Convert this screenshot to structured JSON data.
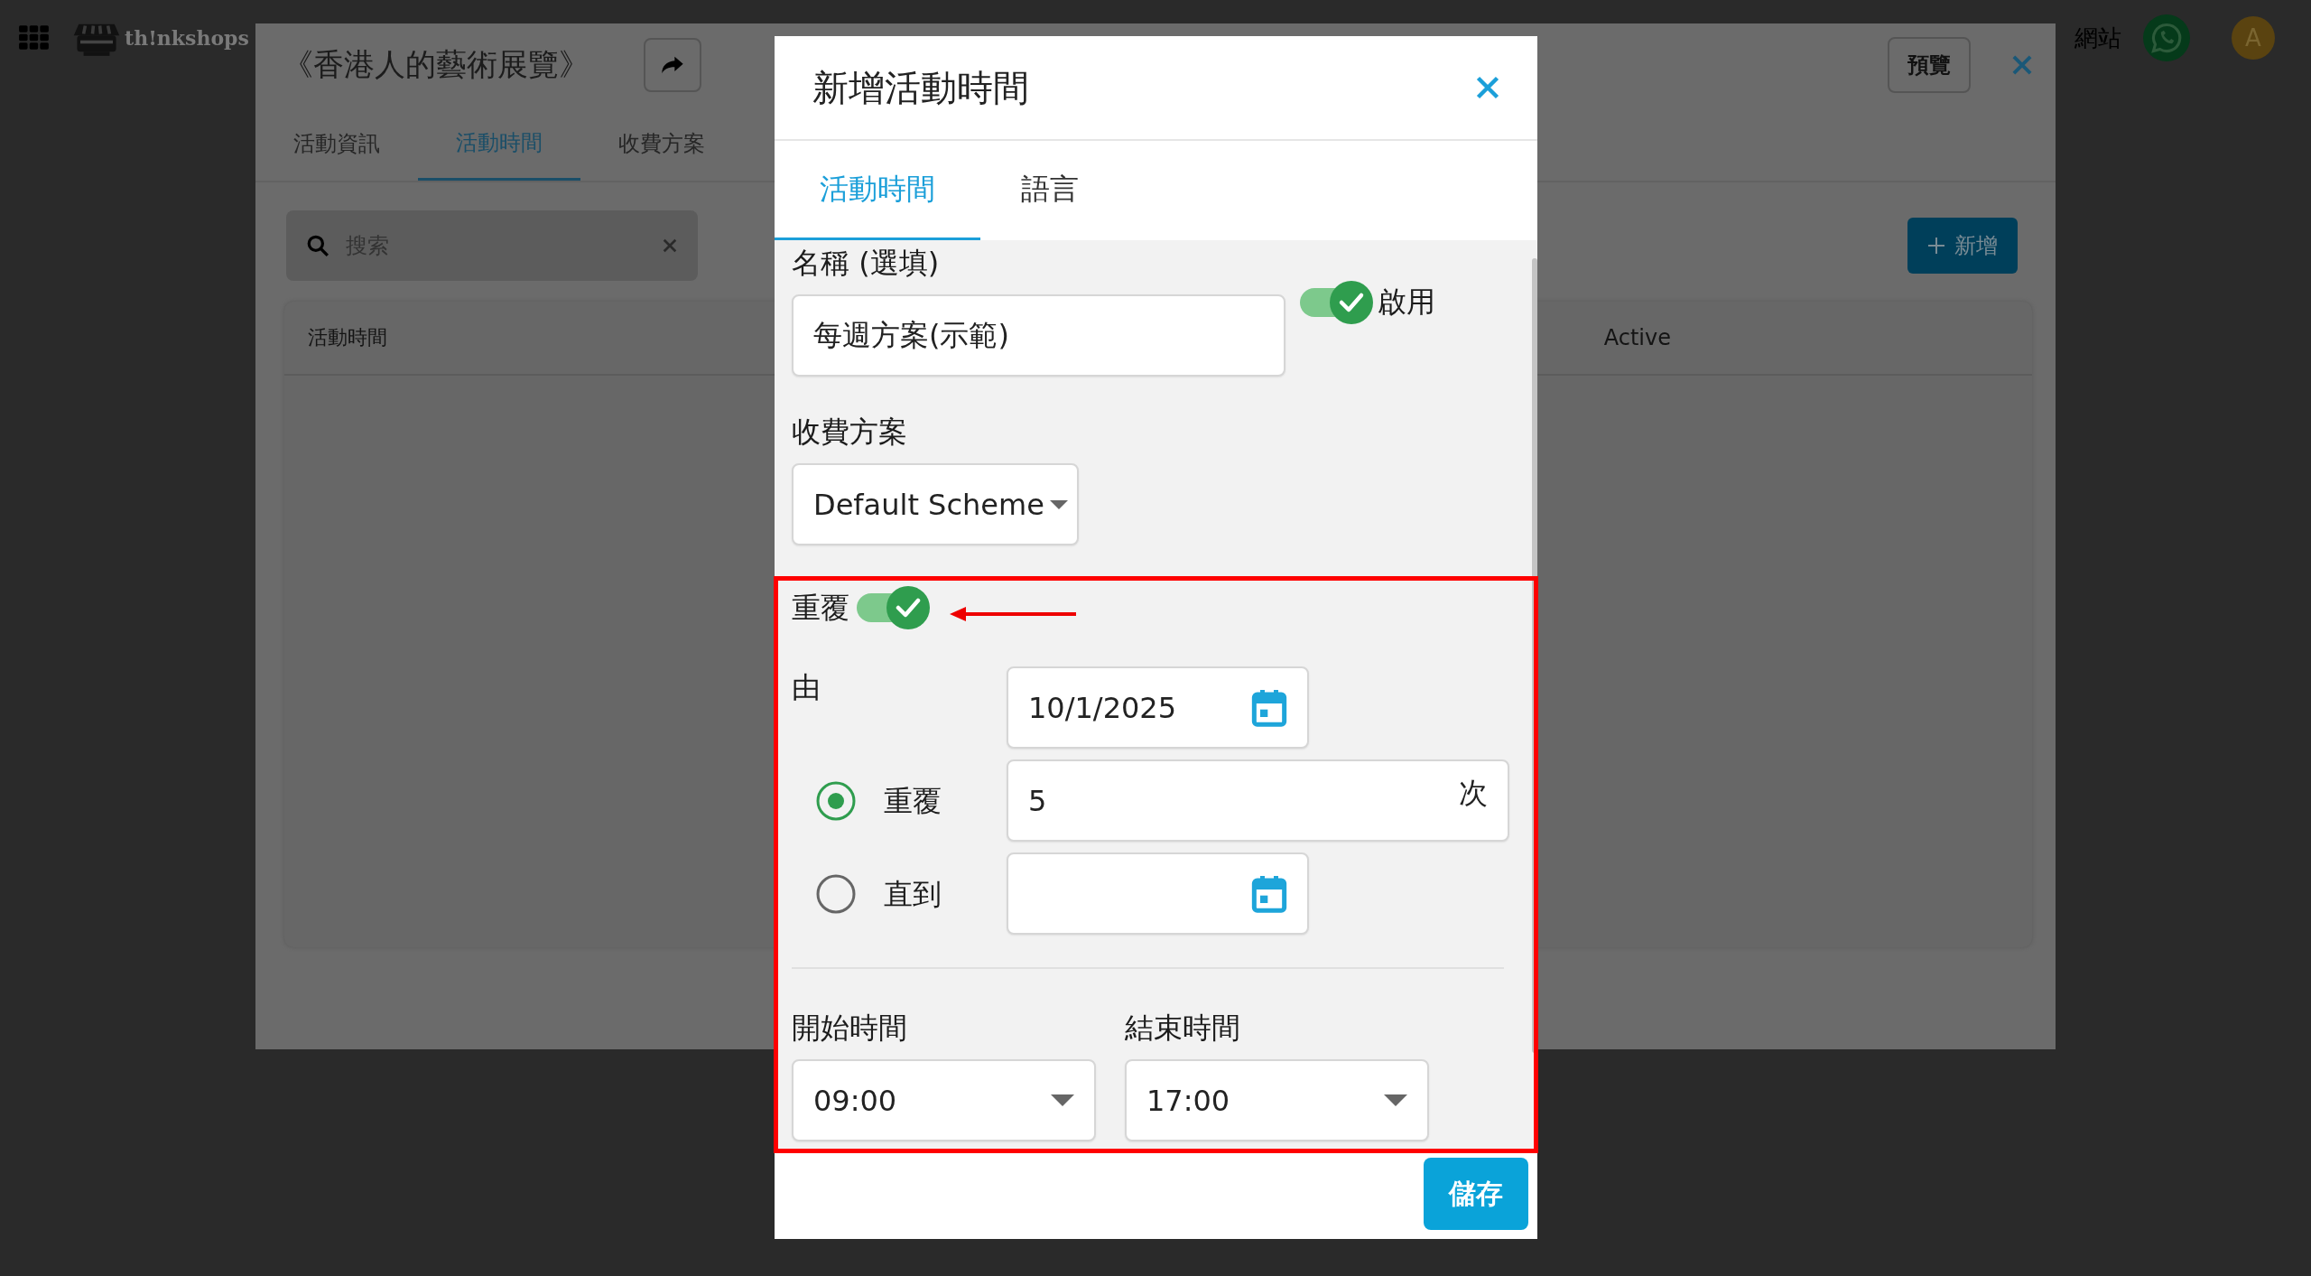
{
  "topbar": {
    "logo": "th!nkshops",
    "site_link": "網站",
    "avatar": "A"
  },
  "background_panel": {
    "title": "《香港人的藝術展覽》",
    "preview_button": "預覽",
    "tabs": [
      {
        "label": "活動資訊",
        "selected": false
      },
      {
        "label": "活動時間",
        "selected": true
      },
      {
        "label": "收費方案",
        "selected": false
      }
    ],
    "search": {
      "placeholder": "搜索"
    },
    "add_button": "新增",
    "table": {
      "columns": [
        "活動時間",
        "Active"
      ]
    }
  },
  "dialog": {
    "title": "新增活動時間",
    "tabs": [
      {
        "label": "活動時間",
        "selected": true
      },
      {
        "label": "語言",
        "selected": false
      }
    ],
    "name_field": {
      "label": "名稱 (選填)",
      "value": "每週方案(示範)"
    },
    "enabled_toggle": {
      "label": "啟用",
      "on": true
    },
    "pricing": {
      "label": "收費方案",
      "value": "Default Scheme"
    },
    "repeat_toggle": {
      "label": "重覆",
      "on": true
    },
    "from": {
      "label": "由",
      "value": "10/1/2025"
    },
    "end_options": [
      {
        "kind": "count",
        "label": "重覆",
        "selected": true,
        "value": "5",
        "suffix": "次"
      },
      {
        "kind": "date",
        "label": "直到",
        "selected": false
      }
    ],
    "start_time": {
      "label": "開始時間",
      "value": "09:00"
    },
    "end_time": {
      "label": "結束時間",
      "value": "17:00"
    },
    "save_button": "儲存"
  }
}
